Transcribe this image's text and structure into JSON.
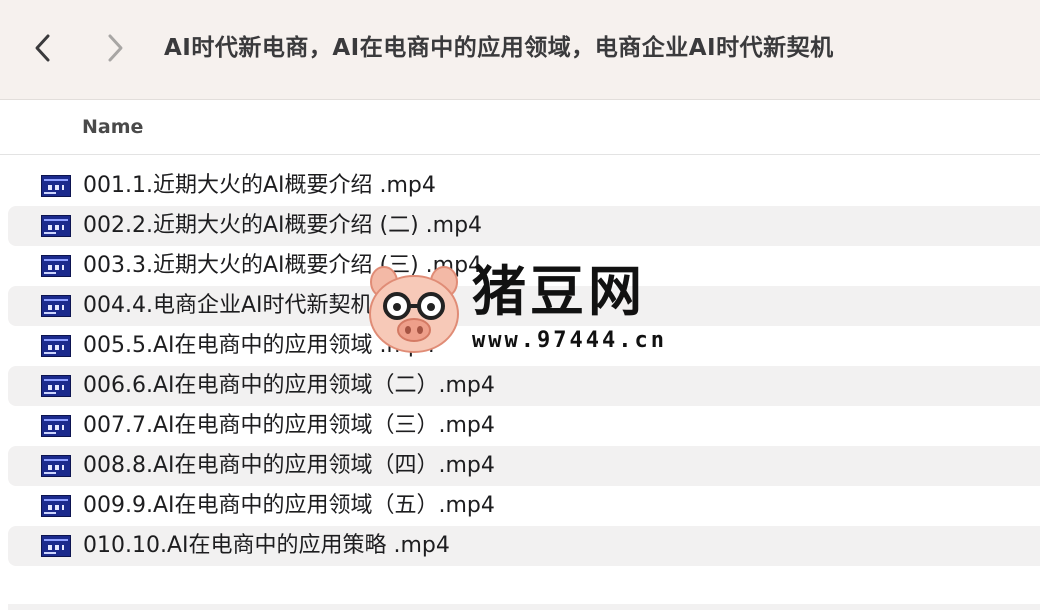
{
  "toolbar": {
    "title": "AI时代新电商，AI在电商中的应用领域，电商企业AI时代新契机",
    "back_icon": "chevron-left-icon",
    "forward_icon": "chevron-right-icon"
  },
  "columns": {
    "name": "Name"
  },
  "files": [
    {
      "name": "001.1.近期大火的AI概要介绍 .mp4"
    },
    {
      "name": "002.2.近期大火的AI概要介绍 (二) .mp4"
    },
    {
      "name": "003.3.近期大火的AI概要介绍 (三) .mp4"
    },
    {
      "name": "004.4.电商企业AI时代新契机 .mp4"
    },
    {
      "name": "005.5.AI在电商中的应用领域 .mp4"
    },
    {
      "name": "006.6.AI在电商中的应用领域（二）.mp4"
    },
    {
      "name": "007.7.AI在电商中的应用领域（三）.mp4"
    },
    {
      "name": "008.8.AI在电商中的应用领域（四）.mp4"
    },
    {
      "name": "009.9.AI在电商中的应用领域（五）.mp4"
    },
    {
      "name": "010.10.AI在电商中的应用策略 .mp4"
    }
  ],
  "watermark": {
    "title": "猪豆网",
    "url": "www.97444.cn"
  }
}
